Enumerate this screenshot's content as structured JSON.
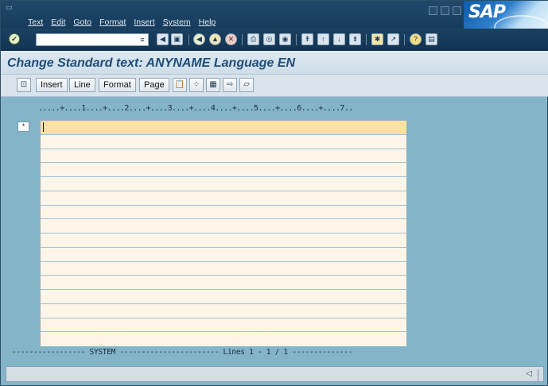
{
  "menu": {
    "items": [
      "Text",
      "Edit",
      "Goto",
      "Format",
      "Insert",
      "System",
      "Help"
    ]
  },
  "logo": {
    "text": "SAP"
  },
  "std_toolbar": {
    "command_value": "",
    "icons": [
      "enter-icon",
      "history-icon",
      "back-arrow-icon",
      "save-icon",
      "back-icon",
      "exit-icon",
      "cancel-icon",
      "print-icon",
      "find-icon",
      "find-next-icon",
      "first-page-icon",
      "previous-page-icon",
      "next-page-icon",
      "last-page-icon",
      "create-session-icon",
      "generate-shortcut-icon",
      "help-icon",
      "layout-menu-icon"
    ]
  },
  "title": "Change Standard text: ANYNAME Language EN",
  "app_toolbar": {
    "buttons": [
      "Insert",
      "Line",
      "Format",
      "Page"
    ],
    "icons": [
      "select-icon",
      "paste-icon",
      "mark-block-icon",
      "cut-icon",
      "insert-document-icon",
      "comment-icon"
    ]
  },
  "editor": {
    "ruler": ".....+....1....+....2....+....3....+....4....+....5....+....6....+....7..",
    "line_marker": "*",
    "line_count": 16,
    "active_line": 1
  },
  "footer": {
    "status_text": "----------------- SYSTEM ----------------------- Lines 1 - 1 / 1 --------------"
  },
  "colors": {
    "menu_bg": "#163b5c",
    "title_text": "#1f4d7a",
    "canvas_bg": "#83b4c8",
    "editor_bg": "#fdf6e8",
    "active_line_bg": "#fbe2a2"
  }
}
